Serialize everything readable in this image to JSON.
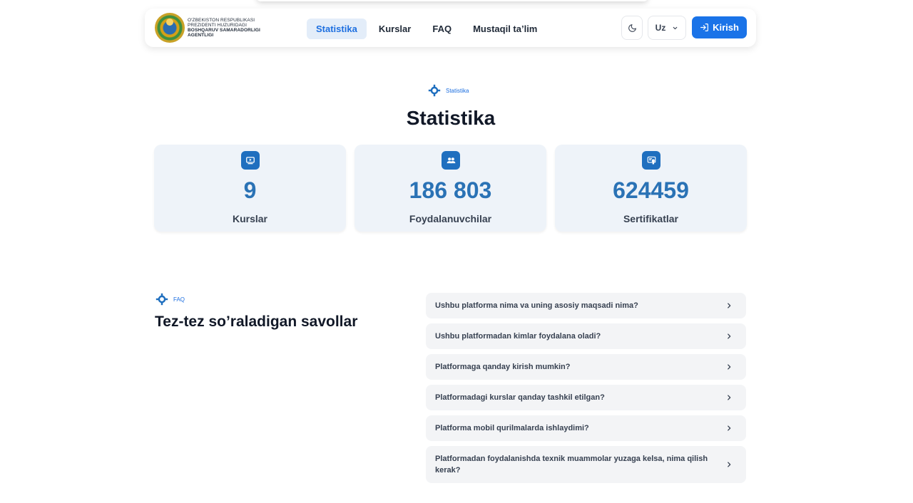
{
  "header": {
    "logo_lines": [
      "O'zbekiston Respublikasi",
      "Prezidenti huzuridagi",
      "Boshqaruv samaradorligi",
      "agentligi"
    ],
    "nav": [
      {
        "label": "Statistika",
        "active": true
      },
      {
        "label": "Kurslar",
        "active": false
      },
      {
        "label": "FAQ",
        "active": false
      },
      {
        "label": "Mustaqil ta’lim",
        "active": false
      }
    ],
    "theme_icon": "moon-icon",
    "language": "Uz",
    "login_label": "Kirish",
    "accent_color": "#1a73e8"
  },
  "stats": {
    "badge": "Statistika",
    "title": "Statistika",
    "cards": [
      {
        "icon": "video-play-icon",
        "value": "9",
        "label": "Kurslar"
      },
      {
        "icon": "users-icon",
        "value": "186 803",
        "label": "Foydalanuvchilar"
      },
      {
        "icon": "certificate-icon",
        "value": "624459",
        "label": "Sertifikatlar"
      }
    ],
    "value_color": "#2a72b5"
  },
  "faq": {
    "badge": "FAQ",
    "title": "Tez-tez so’raladigan savollar",
    "items": [
      "Ushbu platforma nima va uning asosiy maqsadi nima?",
      "Ushbu platformadan kimlar foydalana oladi?",
      "Platformaga qanday kirish mumkin?",
      "Platformadagi kurslar qanday tashkil etilgan?",
      "Platforma mobil qurilmalarda ishlaydimi?",
      "Platformadan foydalanishda texnik muammolar yuzaga kelsa, nima qilish kerak?"
    ]
  }
}
